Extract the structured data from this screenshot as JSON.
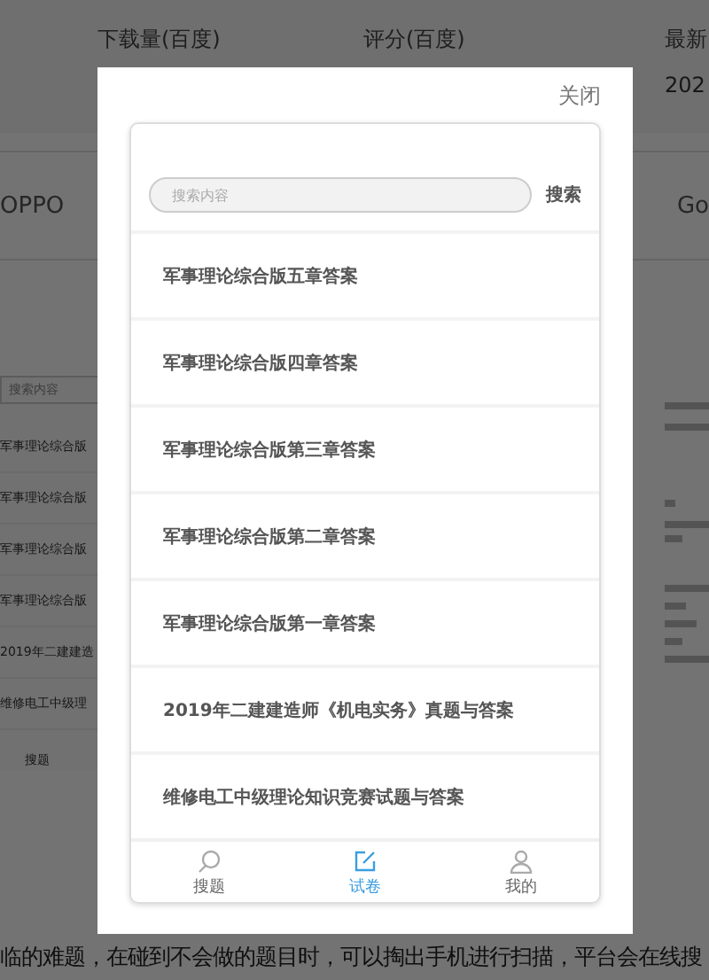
{
  "background": {
    "header": [
      "下载量(百度)",
      "评分(百度)",
      "最新"
    ],
    "header_value": "202",
    "row": [
      "OPPO",
      "Go"
    ],
    "side_panel": {
      "search_placeholder": "搜索内容",
      "items": [
        "军事理论综合版",
        "军事理论综合版",
        "军事理论综合版",
        "军事理论综合版",
        "2019年二建建造",
        "维修电工中级理"
      ],
      "tab": "搜题"
    },
    "paragraph": "临的难题，在碰到不会做的题目时，可以掏出手机进行扫描，平台会在线搜"
  },
  "dialog": {
    "close": "关闭",
    "search": {
      "placeholder": "搜索内容",
      "button": "搜索"
    },
    "items": [
      "军事理论综合版五章答案",
      "军事理论综合版四章答案",
      "军事理论综合版第三章答案",
      "军事理论综合版第二章答案",
      "军事理论综合版第一章答案",
      "2019年二建建造师《机电实务》真题与答案",
      "维修电工中级理论知识竞赛试题与答案"
    ],
    "tabs": [
      {
        "label": "搜题",
        "kind": "search",
        "selected": false
      },
      {
        "label": "试卷",
        "kind": "paper",
        "selected": true
      },
      {
        "label": "我的",
        "kind": "profile",
        "selected": false
      }
    ]
  }
}
